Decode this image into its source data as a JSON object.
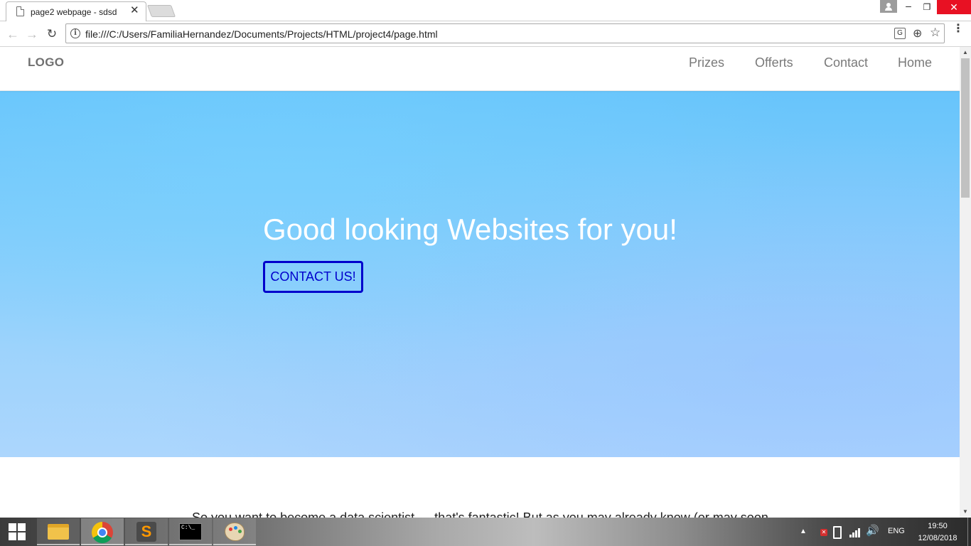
{
  "browser": {
    "tab": {
      "title": "page2 webpage - sdsd",
      "close": "✕"
    },
    "window_controls": {
      "minimize": "–",
      "restore": "❐",
      "close": "✕"
    },
    "toolbar": {
      "back": "←",
      "forward": "→",
      "reload": "↻"
    },
    "address": {
      "url": "file:///C:/Users/FamiliaHernandez/Documents/Projects/HTML/project4/page.html",
      "info": "i",
      "translate": "G",
      "zoom": "⊕",
      "bookmark": "☆",
      "menu": "⋮"
    }
  },
  "site": {
    "logo": "LOGO",
    "nav": [
      "Prizes",
      "Offerts",
      "Contact",
      "Home"
    ],
    "hero": {
      "title": "Good looking Websites for you!",
      "cta": "CONTACT US!"
    },
    "body_text": "So you want to become a data scientist — that's fantastic! But as you may already know (or may soon"
  },
  "scrollbar": {
    "up": "▲",
    "down": "▼"
  },
  "taskbar": {
    "tray": {
      "chevron": "▲",
      "volume": "🔊",
      "language": "ENG",
      "time": "19:50",
      "date": "12/08/2018"
    },
    "cmd_text": "C:\\_",
    "sublime_glyph": "S"
  },
  "colors": {
    "hero_top": "#67c4fb",
    "hero_bottom": "#acd6fd",
    "cta": "#0000cc",
    "close_red": "#e81123"
  }
}
